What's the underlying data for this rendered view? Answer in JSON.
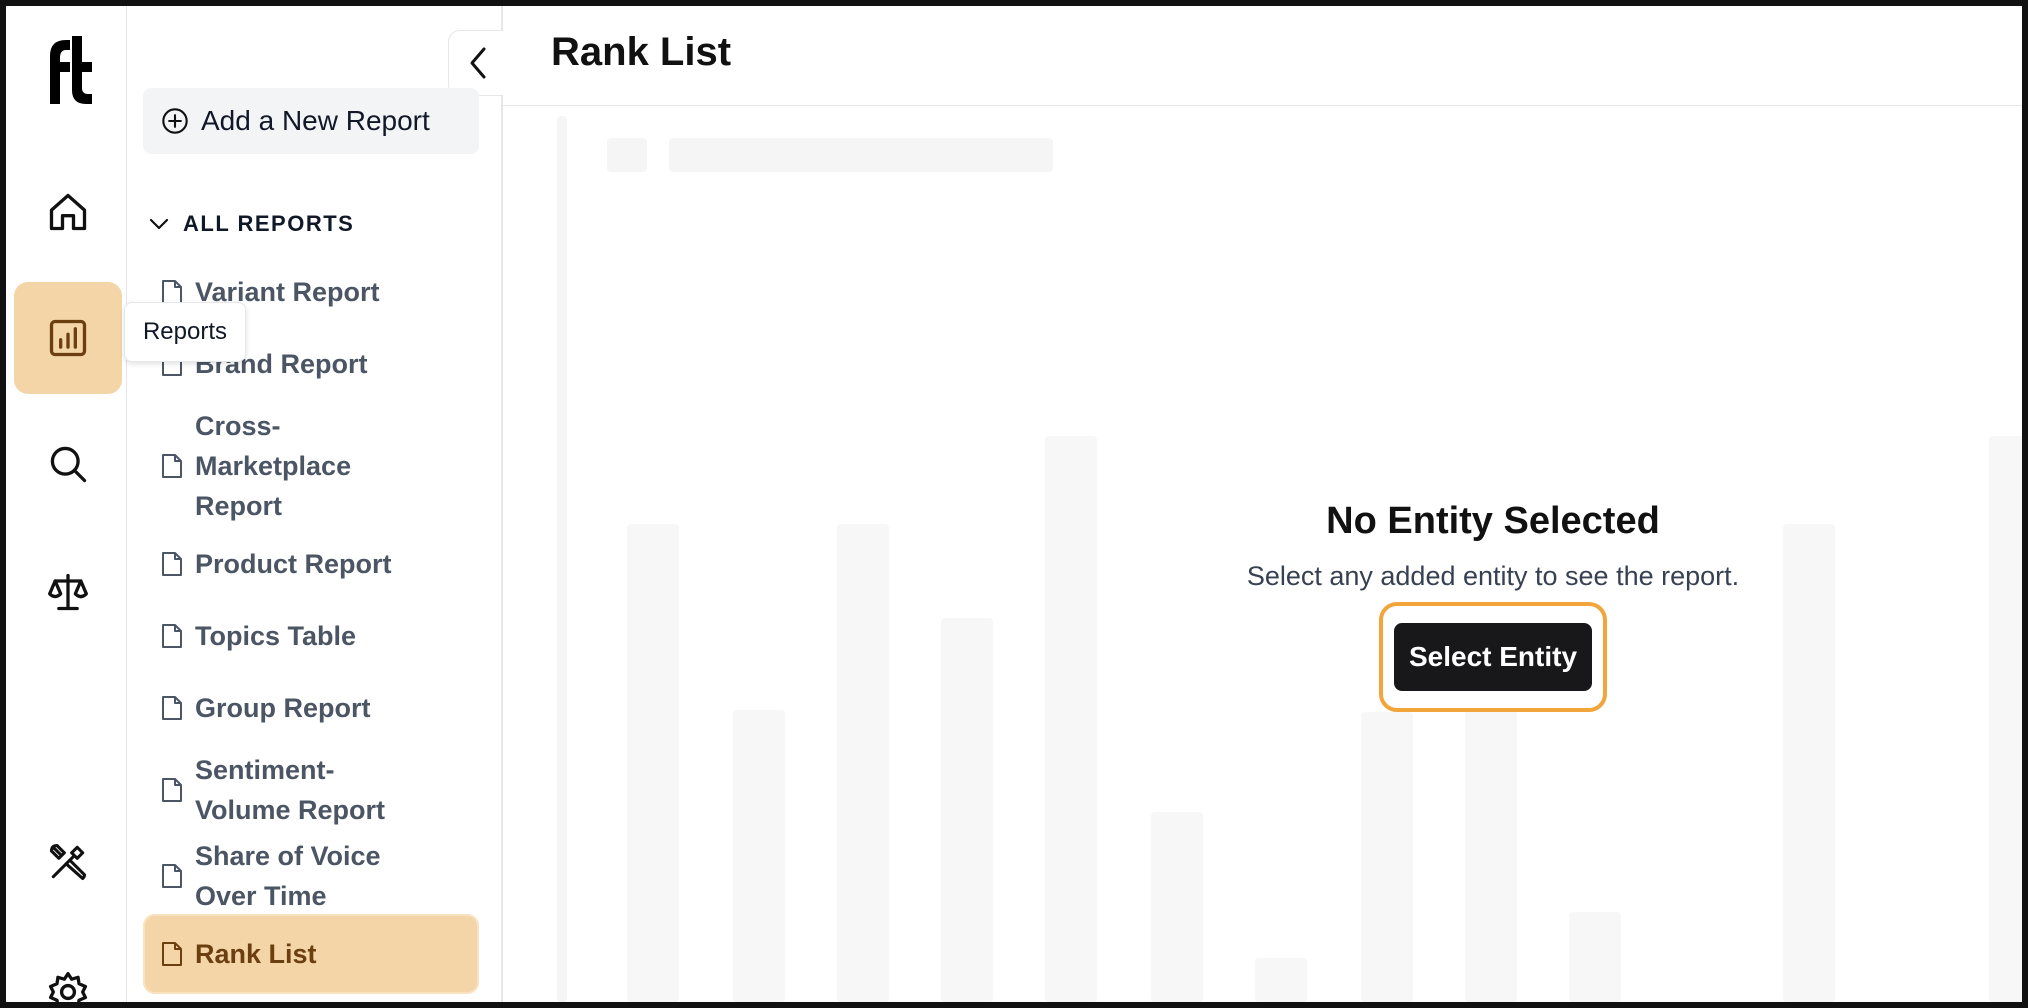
{
  "rail": {
    "items": [
      {
        "name": "home",
        "icon": "home-icon"
      },
      {
        "name": "reports",
        "icon": "bar-chart-icon",
        "active": true
      },
      {
        "name": "search",
        "icon": "search-icon"
      },
      {
        "name": "compare",
        "icon": "scale-icon"
      },
      {
        "name": "tools",
        "icon": "tools-icon"
      },
      {
        "name": "settings",
        "icon": "gear-icon"
      }
    ],
    "tooltip": "Reports"
  },
  "sidebar": {
    "add_report_label": "Add a New Report",
    "section_label": "ALL REPORTS",
    "items": [
      {
        "label": "Variant Report"
      },
      {
        "label": "Brand Report"
      },
      {
        "label": "Cross-Marketplace Report"
      },
      {
        "label": "Product Report"
      },
      {
        "label": "Topics Table"
      },
      {
        "label": "Group Report"
      },
      {
        "label": "Sentiment-Volume Report"
      },
      {
        "label": "Share of Voice Over Time"
      },
      {
        "label": "Rank List",
        "active": true
      }
    ]
  },
  "main": {
    "title": "Rank List",
    "empty_title": "No Entity Selected",
    "empty_message": "Select any added entity to see the report.",
    "select_button": "Select Entity"
  },
  "colors": {
    "active_bg": "#f3d5a8",
    "highlight_border": "#f2a53a",
    "button_bg": "#18181b"
  }
}
